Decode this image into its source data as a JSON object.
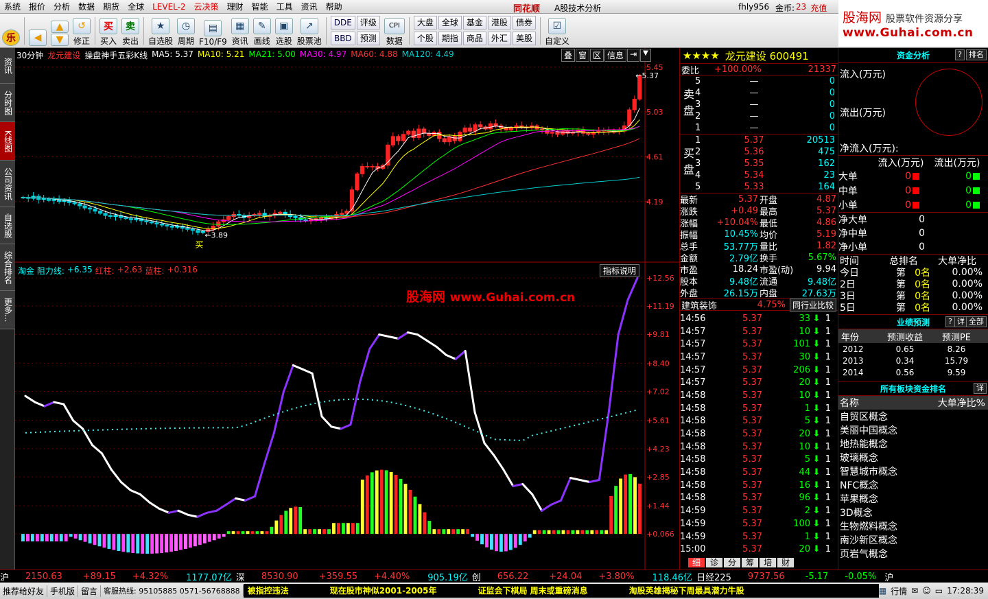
{
  "menu": [
    "系统",
    "报价",
    "分析",
    "数据",
    "期货",
    "全球",
    "LEVEL-2",
    "云决策",
    "理财",
    "智能",
    "工具",
    "资讯",
    "帮助"
  ],
  "menu_brand": "同花顺",
  "menu_subtitle": "A股技术分析",
  "menu_user": "fhly956",
  "menu_coins_label": "金币:",
  "menu_coins": "23",
  "menu_recharge": "充值",
  "logo": {
    "title": "股海网",
    "tagline": "股票软件资源分享",
    "url": "www.Guhai.com.cn"
  },
  "toolbar": {
    "buttons": [
      "修正",
      "买入",
      "卖出",
      "自选股",
      "周期",
      "F10/F9",
      "资讯",
      "画线",
      "选股",
      "股票池"
    ],
    "grid1": [
      "DDE",
      "评级",
      "BBD",
      "预测"
    ],
    "grid1b": [
      "CPI",
      "数据"
    ],
    "grid2": [
      "大盘",
      "全球",
      "基金",
      "港股",
      "债券",
      "个股",
      "期指",
      "商品",
      "外汇",
      "美股"
    ],
    "custom": "自定义",
    "buy_icon": "买",
    "sell_icon": "卖"
  },
  "leftnav": [
    "资讯",
    "分时图",
    "K线图",
    "公司资讯",
    "自选股",
    "综合排名",
    "更多..."
  ],
  "chart_header": {
    "period": "30分钟",
    "stock": "龙元建设",
    "indicator_name": "操盘神手五彩K线",
    "ma": [
      {
        "label": "MA5: 5.37",
        "color": "#ffffff"
      },
      {
        "label": "MA10: 5.21",
        "color": "#ffff00"
      },
      {
        "label": "MA21: 5.00",
        "color": "#00ff00"
      },
      {
        "label": "MA30: 4.97",
        "color": "#ff00ff"
      },
      {
        "label": "MA60: 4.88",
        "color": "#ff3333"
      },
      {
        "label": "MA120: 4.49",
        "color": "#00cccc"
      }
    ],
    "buttons": [
      "叠",
      "窗",
      "区",
      "信息"
    ]
  },
  "sub_header": {
    "name": "淘金 阻力线:",
    "value": "+6.35",
    "red_label": "红柱:",
    "red": "+2.63",
    "blue_label": "蓝柱:",
    "blue": "+0.316",
    "explain": "指标说明"
  },
  "watermark": {
    "site": "股海网",
    "url": "www.Guhai.com.cn"
  },
  "chart_data": {
    "type": "candlestick",
    "main_axis": [
      "5.45",
      "5.03",
      "4.61",
      "4.19"
    ],
    "sub_axis": [
      "+12.56",
      "+11.19",
      "+9.81",
      "+8.40",
      "+7.02",
      "+5.61",
      "+4.23",
      "+2.85",
      "+1.44",
      "+0.066"
    ],
    "low_label": "3.89",
    "high_label": "5.37",
    "buy_marker": "买",
    "ylim_main": [
      3.7,
      5.5
    ],
    "ylim_sub": [
      -1.0,
      13.0
    ],
    "closes": [
      4.23,
      4.22,
      4.24,
      4.21,
      4.22,
      4.2,
      4.21,
      4.19,
      4.2,
      4.18,
      4.17,
      4.15,
      4.13,
      4.12,
      4.1,
      4.08,
      4.06,
      4.05,
      4.06,
      4.04,
      4.03,
      4.02,
      4.03,
      4.01,
      4.0,
      3.99,
      3.98,
      3.97,
      3.96,
      3.95,
      3.96,
      3.94,
      3.93,
      3.92,
      3.9,
      3.91,
      3.93,
      3.96,
      4.0,
      4.02,
      4.05,
      4.07,
      4.06,
      4.04,
      4.06,
      4.07,
      4.08,
      4.05,
      4.06,
      4.08,
      4.09,
      4.07,
      4.05,
      4.04,
      4.02,
      4.01,
      4.02,
      4.03,
      4.04,
      4.03,
      4.05,
      4.07,
      4.08,
      4.1,
      4.3,
      4.45,
      4.52,
      4.52,
      4.52,
      4.5,
      4.53,
      4.72,
      4.8,
      4.76,
      4.82,
      4.85,
      4.79,
      4.87,
      4.83,
      4.81,
      4.84,
      4.78,
      4.75,
      4.8,
      4.76,
      4.84,
      4.88,
      4.85,
      4.91,
      4.89,
      4.87,
      4.92,
      4.9,
      4.88,
      4.86,
      4.88,
      4.9,
      4.89,
      4.88,
      4.9,
      4.87,
      4.86,
      4.83,
      4.84,
      4.82,
      4.85,
      4.83,
      4.84,
      4.86,
      4.83,
      4.82,
      4.84,
      4.85,
      4.86,
      4.84,
      4.86,
      4.85,
      4.9,
      5.05,
      5.15,
      5.37
    ],
    "resist_line": [
      6.8,
      6.5,
      6.3,
      6.5,
      6.4,
      5.6,
      5.2,
      4.4,
      4.0,
      3.2,
      2.6,
      2.2,
      2.0,
      1.6,
      1.3,
      1.1,
      1.2,
      1.0,
      0.9,
      1.1,
      1.2,
      1.5,
      1.8,
      1.7,
      1.9,
      3.5,
      5.0,
      7.0,
      8.3,
      8.1,
      7.9,
      5.8,
      5.3,
      5.2,
      5.4,
      7.5,
      9.1,
      9.8,
      9.7,
      9.6,
      9.9,
      9.8,
      9.5,
      9.2,
      8.8,
      8.6,
      9.0,
      6.0,
      4.5,
      3.9,
      3.2,
      2.4,
      2.5,
      2.0,
      1.2,
      1.5,
      1.7,
      2.8,
      2.7,
      2.6,
      2.7,
      6.0,
      9.8,
      11.5,
      12.56
    ],
    "zero_ref": 0.066
  },
  "quote": {
    "title": "龙元建设 600491",
    "stars": "★★★★",
    "weibi_label": "委比",
    "weibi": "+100.00%",
    "weicha": "21337",
    "sell_label": "卖盘",
    "buy_label": "买盘",
    "sell": [
      {
        "lv": "5",
        "price": "—",
        "vol": "0"
      },
      {
        "lv": "4",
        "price": "—",
        "vol": "0"
      },
      {
        "lv": "3",
        "price": "—",
        "vol": "0"
      },
      {
        "lv": "2",
        "price": "—",
        "vol": "0"
      },
      {
        "lv": "1",
        "price": "—",
        "vol": "0"
      }
    ],
    "buy": [
      {
        "lv": "1",
        "price": "5.37",
        "vol": "20513"
      },
      {
        "lv": "2",
        "price": "5.36",
        "vol": "475"
      },
      {
        "lv": "3",
        "price": "5.35",
        "vol": "162"
      },
      {
        "lv": "4",
        "price": "5.34",
        "vol": "23"
      },
      {
        "lv": "5",
        "price": "5.33",
        "vol": "164"
      }
    ],
    "stats": [
      [
        "最新",
        "5.37",
        "开盘",
        "4.87"
      ],
      [
        "涨跌",
        "+0.49",
        "最高",
        "5.37"
      ],
      [
        "涨幅",
        "+10.04%",
        "最低",
        "4.86"
      ],
      [
        "振幅",
        "10.45%",
        "均价",
        "5.19"
      ],
      [
        "总手",
        "53.77万",
        "量比",
        "1.82"
      ],
      [
        "金额",
        "2.79亿",
        "换手",
        "5.67%"
      ],
      [
        "市盈",
        "18.24",
        "市盈(动)",
        "9.94"
      ],
      [
        "股本",
        "9.48亿",
        "流通",
        "9.48亿"
      ],
      [
        "外盘",
        "26.15万",
        "内盘",
        "27.63万"
      ]
    ],
    "sector": "建筑装饰",
    "sector_pct": "4.75%",
    "sector_btn": "同行业比较",
    "ticks": [
      [
        "14:56",
        "5.37",
        "33",
        "1"
      ],
      [
        "14:57",
        "5.37",
        "10",
        "1"
      ],
      [
        "14:57",
        "5.37",
        "101",
        "1"
      ],
      [
        "14:57",
        "5.37",
        "30",
        "1"
      ],
      [
        "14:57",
        "5.37",
        "206",
        "1"
      ],
      [
        "14:57",
        "5.37",
        "20",
        "1"
      ],
      [
        "14:58",
        "5.37",
        "10",
        "1"
      ],
      [
        "14:58",
        "5.37",
        "1",
        "1"
      ],
      [
        "14:58",
        "5.37",
        "5",
        "1"
      ],
      [
        "14:58",
        "5.37",
        "20",
        "1"
      ],
      [
        "14:58",
        "5.37",
        "10",
        "1"
      ],
      [
        "14:58",
        "5.37",
        "5",
        "1"
      ],
      [
        "14:58",
        "5.37",
        "44",
        "1"
      ],
      [
        "14:58",
        "5.37",
        "16",
        "1"
      ],
      [
        "14:58",
        "5.37",
        "96",
        "1"
      ],
      [
        "14:59",
        "5.37",
        "2",
        "1"
      ],
      [
        "14:59",
        "5.37",
        "100",
        "1"
      ],
      [
        "14:59",
        "5.37",
        "1",
        "1"
      ],
      [
        "15:00",
        "5.37",
        "20",
        "1"
      ]
    ],
    "tabs": [
      "细",
      "诊",
      "分",
      "筹",
      "培",
      "财"
    ]
  },
  "fund": {
    "title": "资金分析",
    "title_btn1": "?",
    "title_btn2": "排名",
    "inflow": "流入(万元)",
    "outflow": "流出(万元)",
    "net": "净流入(万元):",
    "col_in": "流入(万元)",
    "col_out": "流出(万元)",
    "rows": [
      [
        "大单",
        "0",
        "0"
      ],
      [
        "中单",
        "0",
        "0"
      ],
      [
        "小单",
        "0",
        "0"
      ]
    ],
    "net_rows": [
      [
        "净大单",
        "0"
      ],
      [
        "净中单",
        "0"
      ],
      [
        "净小单",
        "0"
      ]
    ],
    "rank_head": [
      "时间",
      "总排名",
      "大单净比"
    ],
    "rank_rows": [
      [
        "今日",
        "第",
        "0名",
        "0.00%"
      ],
      [
        "2日",
        "第",
        "0名",
        "0.00%"
      ],
      [
        "3日",
        "第",
        "0名",
        "0.00%"
      ],
      [
        "5日",
        "第",
        "0名",
        "0.00%"
      ]
    ],
    "perf_title": "业绩预测",
    "perf_btns": [
      "?",
      "详",
      "全部"
    ],
    "perf_head": [
      "年份",
      "预测收益",
      "预测PE"
    ],
    "perf_rows": [
      [
        "2012",
        "0.65",
        "8.26"
      ],
      [
        "2013",
        "0.34",
        "15.79"
      ],
      [
        "2014",
        "0.56",
        "9.59"
      ]
    ],
    "sector_title": "所有板块资金排名",
    "sector_btn": "详",
    "sector_head": [
      "名称",
      "大单净比%"
    ],
    "sectors": [
      "自贸区概念",
      "美丽中国概念",
      "地热能概念",
      "玻璃概念",
      "智慧城市概念",
      "NFC概念",
      "苹果概念",
      "3D概念",
      "生物燃料概念",
      "南沙新区概念",
      "页岩气概念"
    ]
  },
  "ticker": [
    {
      "name": "沪",
      "v": "2150.63",
      "chg": "+89.15",
      "pct": "+4.32%",
      "amt": "1177.07亿"
    },
    {
      "name": "深",
      "v": "8530.90",
      "chg": "+359.55",
      "pct": "+4.40%",
      "amt": "905.19亿"
    },
    {
      "name": "创",
      "v": "656.22",
      "chg": "+24.04",
      "pct": "+3.80%",
      "amt": "118.46亿"
    },
    {
      "name": "日经225",
      "v": "9737.56",
      "chg": "-5.17",
      "pct": "-0.05%",
      "amt": ""
    }
  ],
  "ticker_end": "沪",
  "status": {
    "items": [
      "推荐给好友",
      "手机版",
      "留言",
      "客服热线: 95105885 0571-56768888"
    ],
    "news": [
      "被指控违法",
      "现在股市神似2001-2005年",
      "证监会下棋局 周末或重磅消息",
      "淘股英雄揭秘下周最具潜力牛股"
    ],
    "quote_btn": "行情",
    "time": "17:28:39"
  }
}
